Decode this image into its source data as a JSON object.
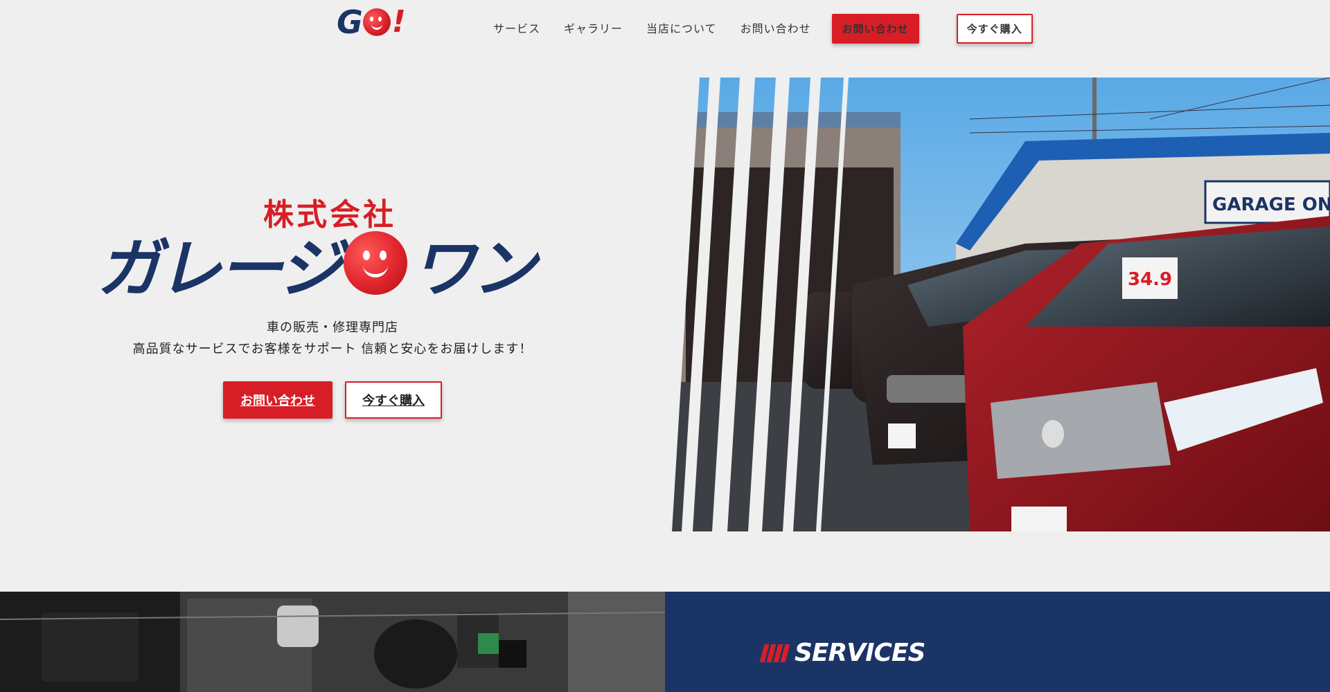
{
  "header": {
    "logo": {
      "letters": "G",
      "mark": "!"
    },
    "nav": [
      "サービス",
      "ギャラリー",
      "当店について",
      "お問い合わせ"
    ],
    "cta_primary": "お問い合わせ",
    "cta_secondary": "今すぐ購入"
  },
  "hero": {
    "company_prefix": "株式会社",
    "name_part1": "ガレージ",
    "name_part2": "ワン",
    "tagline_line1": "車の販売・修理専門店",
    "tagline_line2": "高品質なサービスでお客様をサポート 信頼と安心をお届けします！",
    "cta_primary": "お問い合わせ",
    "cta_secondary": "今すぐ購入",
    "photo_sign": "GARAGE ONE",
    "photo_price": "34.9"
  },
  "services": {
    "title": "SERVICES"
  },
  "colors": {
    "brand_red": "#d71e26",
    "brand_navy": "#1b3466",
    "background": "#efefef"
  }
}
